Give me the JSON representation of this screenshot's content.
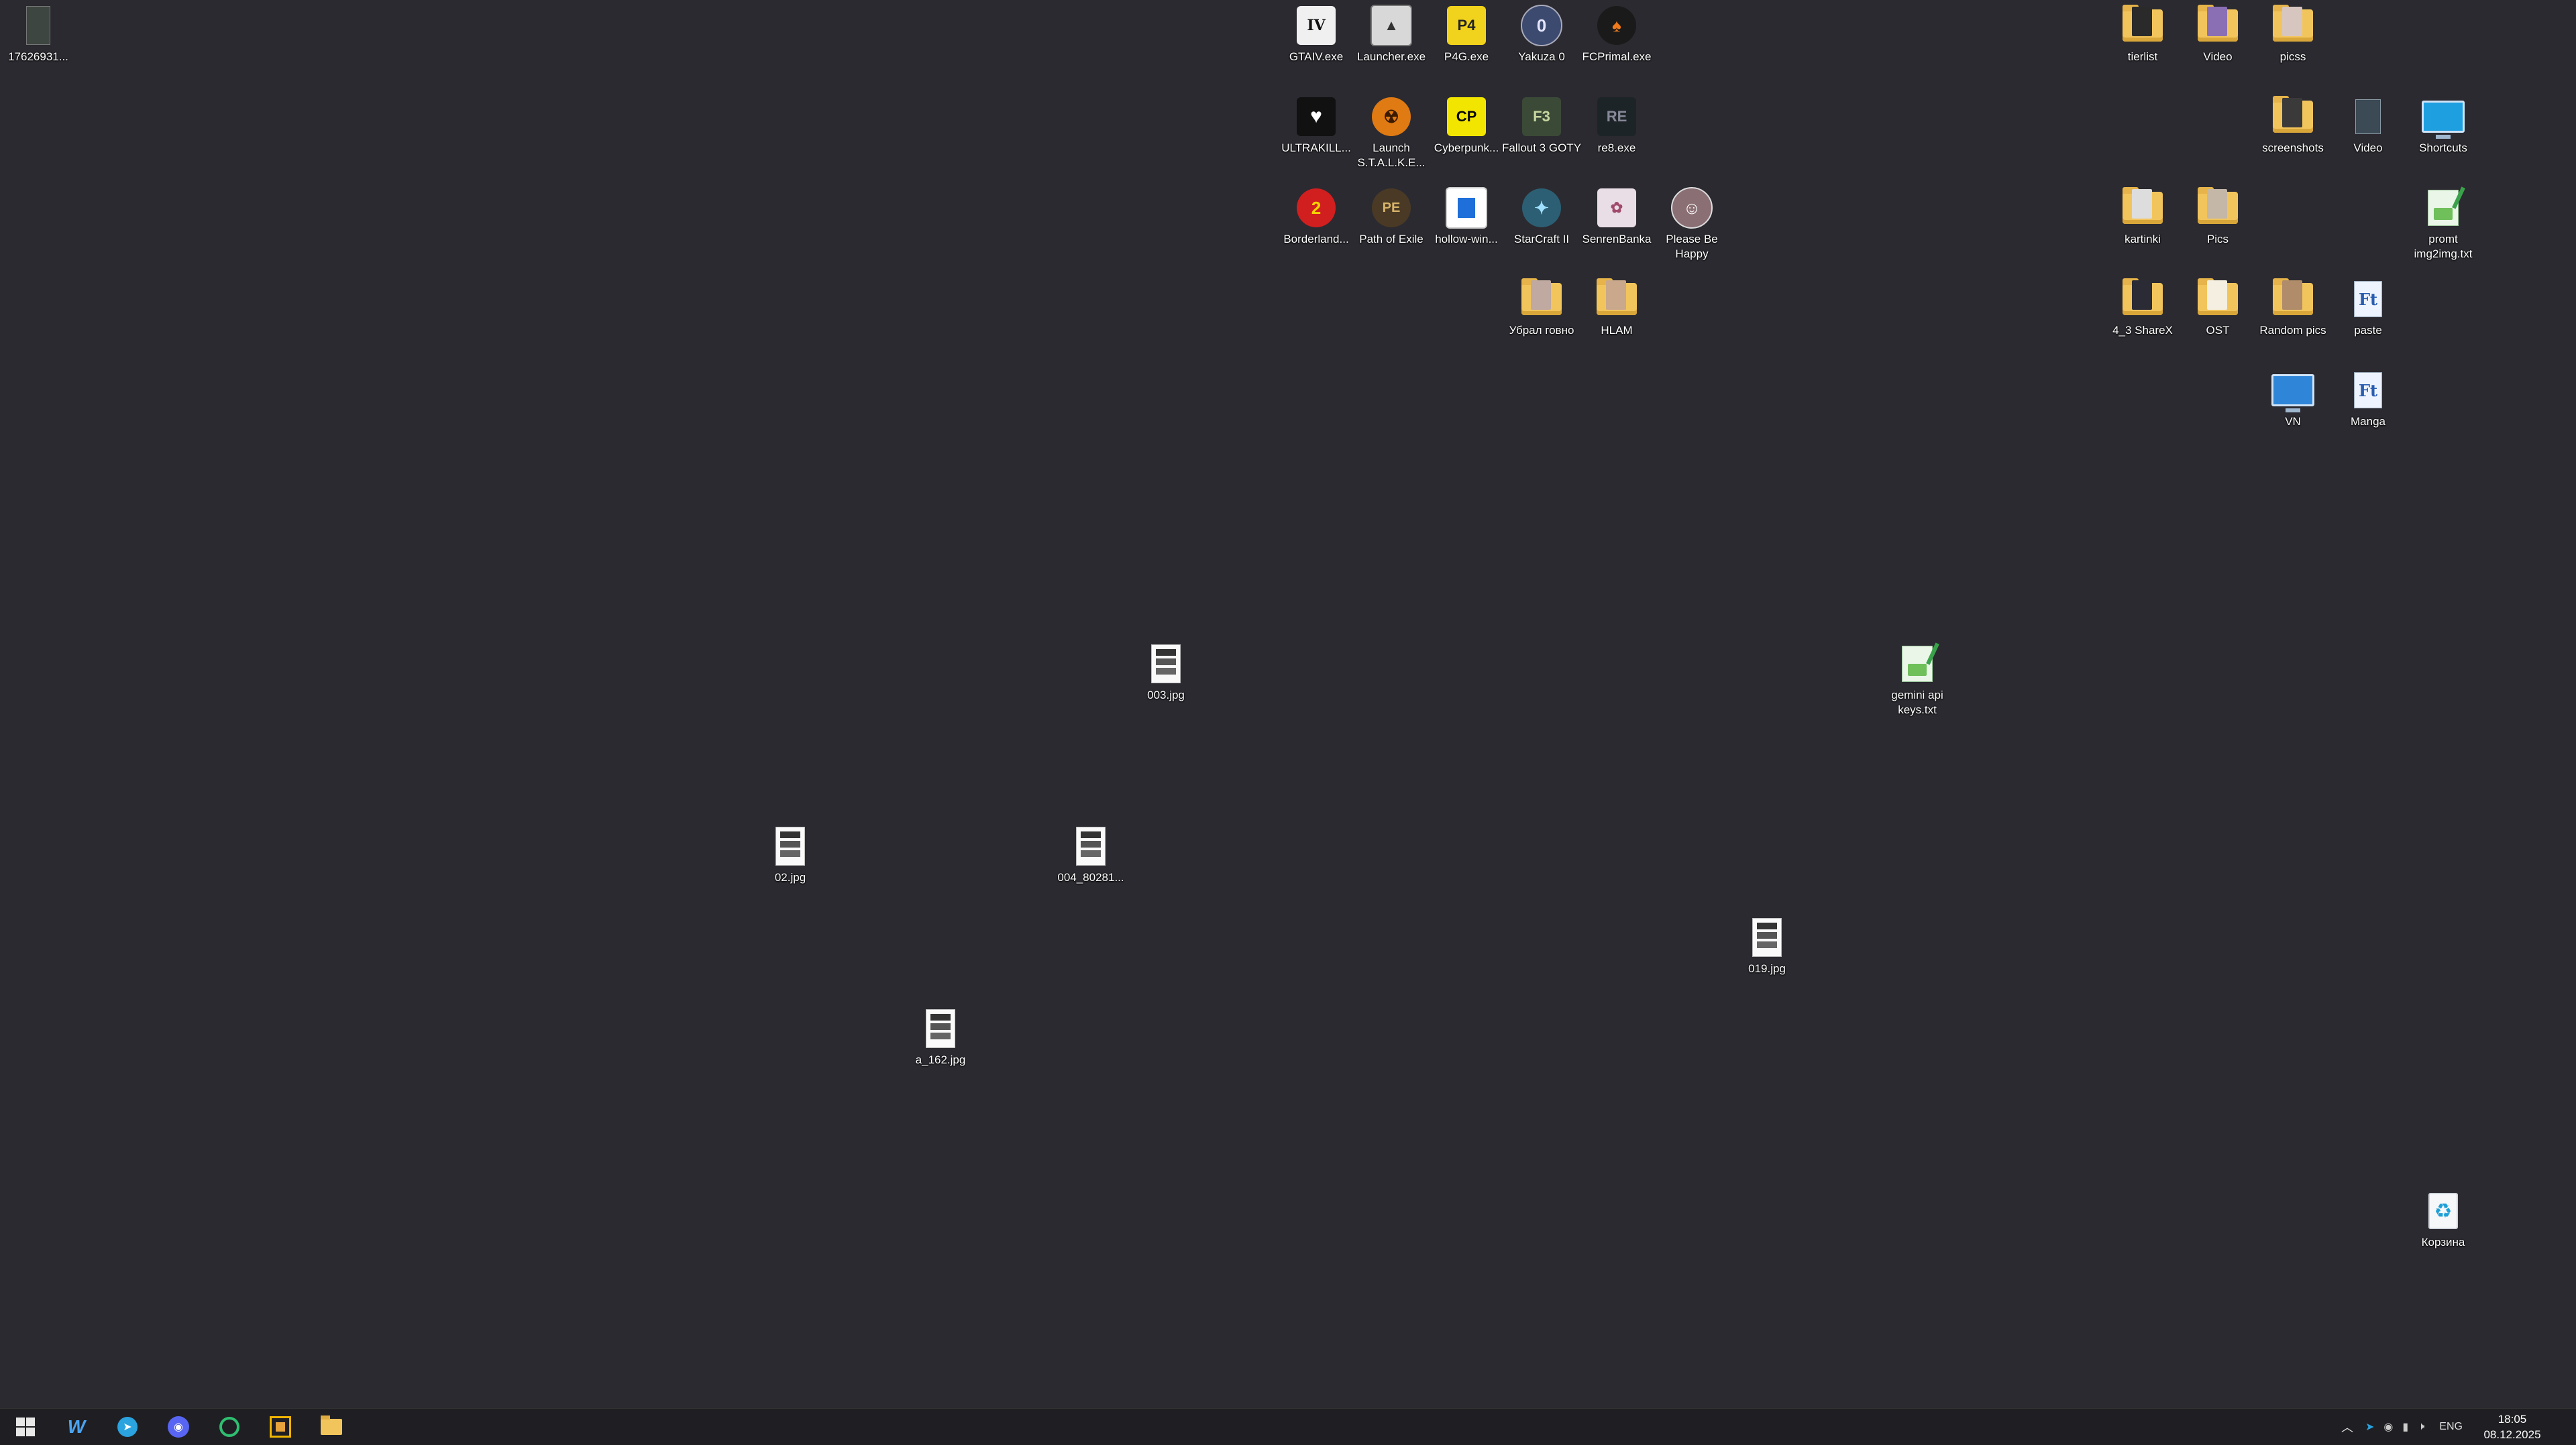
{
  "colors": {
    "desktop_bg": "#2b2a30",
    "taskbar_bg": "#1f1f23",
    "folder": "#f2c55c",
    "label": "#ffffff"
  },
  "desktop": {
    "icons": [
      {
        "id": "i0",
        "label": "17626931...",
        "icon": "image-file-icon"
      },
      {
        "id": "i1",
        "label": "GTAIV.exe",
        "icon": "gtaiv-icon"
      },
      {
        "id": "i2",
        "label": "Launcher.exe",
        "icon": "launcher-icon"
      },
      {
        "id": "i3",
        "label": "P4G.exe",
        "icon": "p4g-icon"
      },
      {
        "id": "i4",
        "label": "Yakuza 0",
        "icon": "yakuza-icon"
      },
      {
        "id": "i5",
        "label": "FCPrimal.exe",
        "icon": "fcprimal-icon"
      },
      {
        "id": "i6",
        "label": "ULTRAKILL...",
        "icon": "ultrakill-icon"
      },
      {
        "id": "i7",
        "label": "Launch S.T.A.L.K.E...",
        "icon": "stalker-icon"
      },
      {
        "id": "i8",
        "label": "Cyberpunk...",
        "icon": "cyberpunk-icon"
      },
      {
        "id": "i9",
        "label": "Fallout 3 GOTY",
        "icon": "fallout-icon"
      },
      {
        "id": "i10",
        "label": "re8.exe",
        "icon": "re8-icon"
      },
      {
        "id": "i11",
        "label": "Borderland...",
        "icon": "borderlands-icon"
      },
      {
        "id": "i12",
        "label": "Path of Exile",
        "icon": "poe-icon"
      },
      {
        "id": "i13",
        "label": "hollow-win...",
        "icon": "hollow-icon"
      },
      {
        "id": "i14",
        "label": "StarCraft II",
        "icon": "starcraft-icon"
      },
      {
        "id": "i15",
        "label": "SenrenBanka",
        "icon": "senren-icon"
      },
      {
        "id": "i16",
        "label": "Please Be Happy",
        "icon": "pleasebehappy-icon"
      },
      {
        "id": "i17",
        "label": "Убрал говно",
        "icon": "folder-icon"
      },
      {
        "id": "i18",
        "label": "HLAM",
        "icon": "folder-icon"
      },
      {
        "id": "i19",
        "label": "tierlist",
        "icon": "folder-icon"
      },
      {
        "id": "i20",
        "label": "Video",
        "icon": "folder-icon"
      },
      {
        "id": "i21",
        "label": "picss",
        "icon": "folder-icon"
      },
      {
        "id": "i22",
        "label": "screenshots",
        "icon": "folder-icon"
      },
      {
        "id": "i23",
        "label": "Video",
        "icon": "video-shortcut-icon"
      },
      {
        "id": "i24",
        "label": "Shortcuts",
        "icon": "shortcuts-icon"
      },
      {
        "id": "i25",
        "label": "kartinki",
        "icon": "folder-icon"
      },
      {
        "id": "i26",
        "label": "Pics",
        "icon": "folder-icon"
      },
      {
        "id": "i27",
        "label": "promt img2img.txt",
        "icon": "text-file-icon"
      },
      {
        "id": "i28",
        "label": "4_3 ShareX",
        "icon": "folder-icon"
      },
      {
        "id": "i29",
        "label": "OST",
        "icon": "folder-icon"
      },
      {
        "id": "i30",
        "label": "Random pics",
        "icon": "folder-icon"
      },
      {
        "id": "i31",
        "label": "paste",
        "icon": "font-file-icon"
      },
      {
        "id": "i32",
        "label": "VN",
        "icon": "vn-monitor-icon"
      },
      {
        "id": "i33",
        "label": "Manga",
        "icon": "font-file-icon"
      },
      {
        "id": "i34",
        "label": "003.jpg",
        "icon": "image-file-icon"
      },
      {
        "id": "i35",
        "label": "gemini api keys.txt",
        "icon": "text-file-icon"
      },
      {
        "id": "i36",
        "label": "02.jpg",
        "icon": "image-file-icon"
      },
      {
        "id": "i37",
        "label": "004_80281...",
        "icon": "image-file-icon"
      },
      {
        "id": "i38",
        "label": "019.jpg",
        "icon": "image-file-icon"
      },
      {
        "id": "i39",
        "label": "a_162.jpg",
        "icon": "image-file-icon"
      },
      {
        "id": "i40",
        "label": "Корзина",
        "icon": "recycle-bin-icon"
      }
    ]
  },
  "taskbar": {
    "apps": [
      {
        "name": "start-button",
        "icon": "windows-icon"
      },
      {
        "name": "taskbar-w-app",
        "icon": "w-app-icon"
      },
      {
        "name": "taskbar-telegram",
        "icon": "telegram-icon"
      },
      {
        "name": "taskbar-discord",
        "icon": "discord-icon"
      },
      {
        "name": "taskbar-green-app",
        "icon": "green-c-icon"
      },
      {
        "name": "taskbar-sharex",
        "icon": "sharex-icon"
      },
      {
        "name": "taskbar-file-explorer",
        "icon": "folder-icon"
      }
    ],
    "tray": {
      "language": "ENG",
      "time": "18:05",
      "date": "08.12.2025"
    }
  }
}
